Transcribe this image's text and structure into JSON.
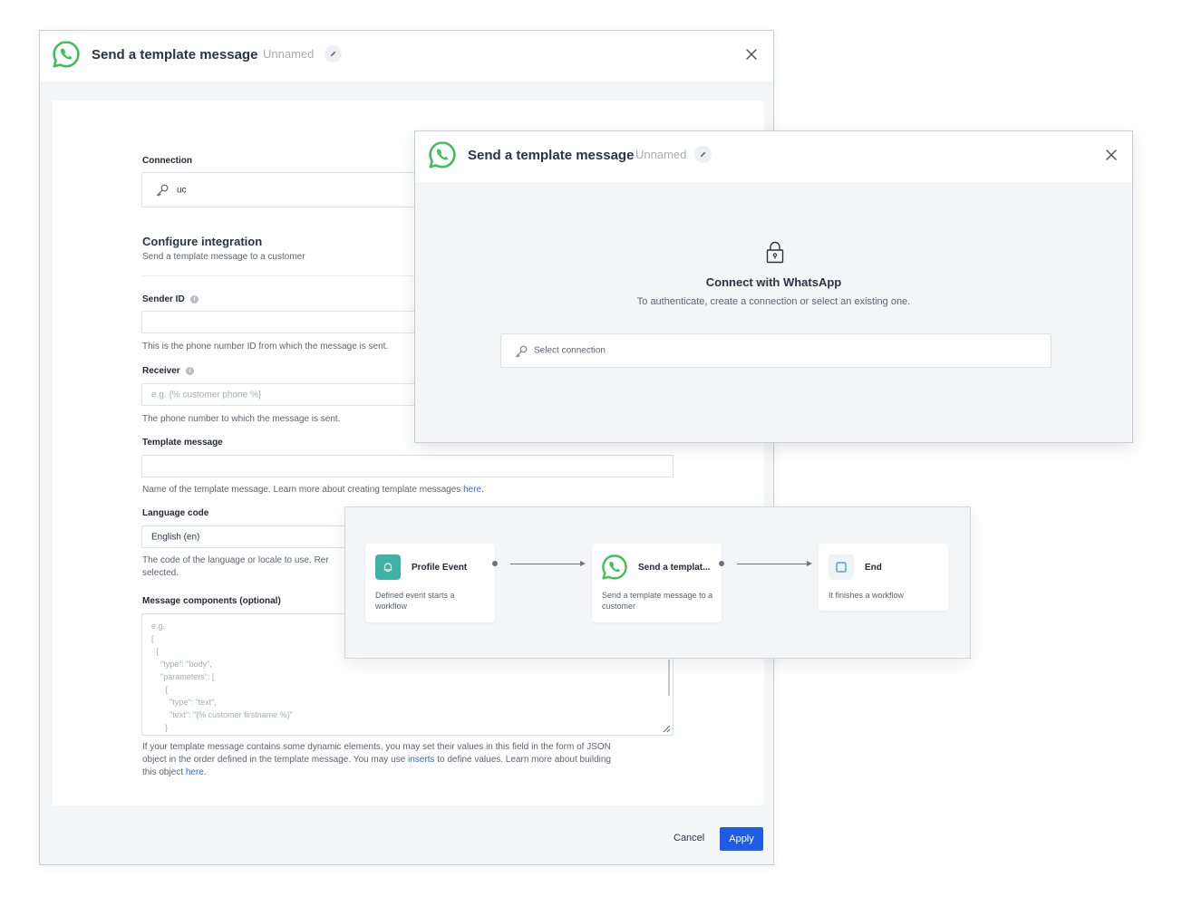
{
  "main_modal": {
    "title": "Send a template message",
    "name_placeholder": "Unnamed",
    "connection": {
      "label": "Connection",
      "value": "uc"
    },
    "configure": {
      "title": "Configure integration",
      "subtitle": "Send a template message to a customer"
    },
    "sender_id": {
      "label": "Sender ID",
      "help": "This is the phone number ID from which the message is sent."
    },
    "receiver": {
      "label": "Receiver",
      "placeholder": "e.g. {% customer phone %}",
      "help": "The phone number to which the message is sent."
    },
    "template_message": {
      "label": "Template message",
      "help_prefix": "Name of the template message. Learn more about creating template messages ",
      "help_link": "here",
      "help_suffix": "."
    },
    "language_code": {
      "label": "Language code",
      "value": "English (en)",
      "help_line1": "The code of the language or locale to use. Rer",
      "help_line2": "selected."
    },
    "message_components": {
      "label": "Message components (optional)",
      "placeholder_lines": [
        "e.g.",
        "[",
        "  {",
        "    \"type\": \"body\",",
        "    \"parameters\": [",
        "      {",
        "        \"type\": \"text\",",
        "        \"text\": \"{% customer firstname %}\"",
        "      }"
      ],
      "help_line1": "If your template message contains some dynamic elements, you may set their values in this field in the form of JSON",
      "help_line2_prefix": "object in the order defined in the template message. You may use ",
      "help_line2_link": "inserts",
      "help_line2_suffix": " to define values. Learn more about building",
      "help_line3_prefix": "this object ",
      "help_line3_link": "here",
      "help_line3_suffix": "."
    },
    "cancel_label": "Cancel",
    "apply_label": "Apply"
  },
  "connect_modal": {
    "title": "Send a template message",
    "name_placeholder": "Unnamed",
    "heading": "Connect with WhatsApp",
    "subheading": "To authenticate, create a connection or select an existing one.",
    "select_placeholder": "Select connection"
  },
  "workflow": {
    "nodes": [
      {
        "title": "Profile Event",
        "description": "Defined event starts a workflow"
      },
      {
        "title": "Send a templat...",
        "description": "Send a template message to a customer"
      },
      {
        "title": "End",
        "description": "It finishes a workflow"
      }
    ]
  },
  "colors": {
    "whatsapp": "#3fbf5a",
    "accent": "#1f5ce6",
    "link": "#2f6bd8",
    "event_teal": "#3fb2a7"
  }
}
